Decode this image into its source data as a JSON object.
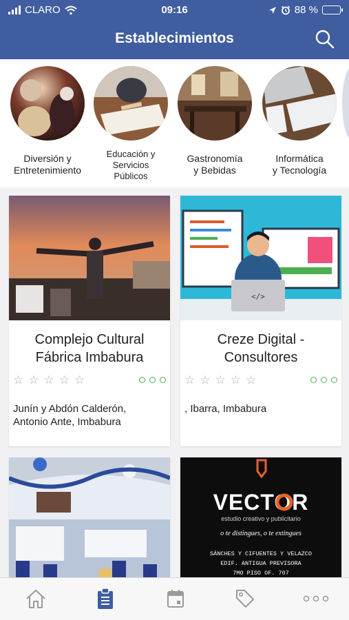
{
  "status_bar": {
    "carrier": "CLARO",
    "time": "09:16",
    "battery": "88 %",
    "battery_level": 0.88,
    "icons": [
      "signal-icon",
      "wifi-icon",
      "location-arrow-icon",
      "alarm-icon",
      "battery-icon"
    ]
  },
  "header": {
    "title": "Establecimientos",
    "background": "#3f5d9f",
    "search_icon": "search-icon"
  },
  "categories": [
    {
      "label_line1": "Diversión y",
      "label_line2": "Entretenimiento",
      "label_line3": ""
    },
    {
      "label_line1": "Educación y",
      "label_line2": "Servicios",
      "label_line3": "Públicos"
    },
    {
      "label_line1": "Gastronomía",
      "label_line2": "y Bebidas",
      "label_line3": ""
    },
    {
      "label_line1": "Informática",
      "label_line2": "y Tecnología",
      "label_line3": ""
    }
  ],
  "establishments": [
    {
      "name_line1": "Complejo Cultural",
      "name_line2": "Fábrica Imbabura",
      "rating": 0,
      "max_rating": 5,
      "address_line1": "Junín y Abdón Calderón,",
      "address_line2": "Antonio Ante, Imbabura"
    },
    {
      "name_line1": "Creze Digital -",
      "name_line2": "Consultores",
      "rating": 0,
      "max_rating": 5,
      "address_line1": ", Ibarra, Imbabura",
      "address_line2": ""
    },
    {
      "name_line1": "",
      "name_line2": "",
      "address_line1": "",
      "address_line2": ""
    },
    {
      "name_line1": "",
      "name_line2": "",
      "logo_text": "VECTOR",
      "logo_subtitle": "estudio creativo y publicitario",
      "slogan": "o te distingues, o te extingues",
      "address_line1": "SÁNCHES Y CIFUENTES Y VELAZCO",
      "address_line2": "EDIF. ANTIGUA PREVISORA",
      "address_line3": "7MO PISO OF. 707"
    }
  ],
  "tabbar": {
    "tabs": [
      "home-icon",
      "clipboard-icon",
      "calendar-icon",
      "tag-icon",
      "more-icon"
    ],
    "active_index": 1,
    "active_color": "#3f5d9f",
    "inactive_color": "#9a9a9a"
  },
  "colors": {
    "accent": "#3f5d9f",
    "star": "#aaaaaa",
    "status_dot": "#4caf50",
    "logo_orange": "#e8622a"
  }
}
